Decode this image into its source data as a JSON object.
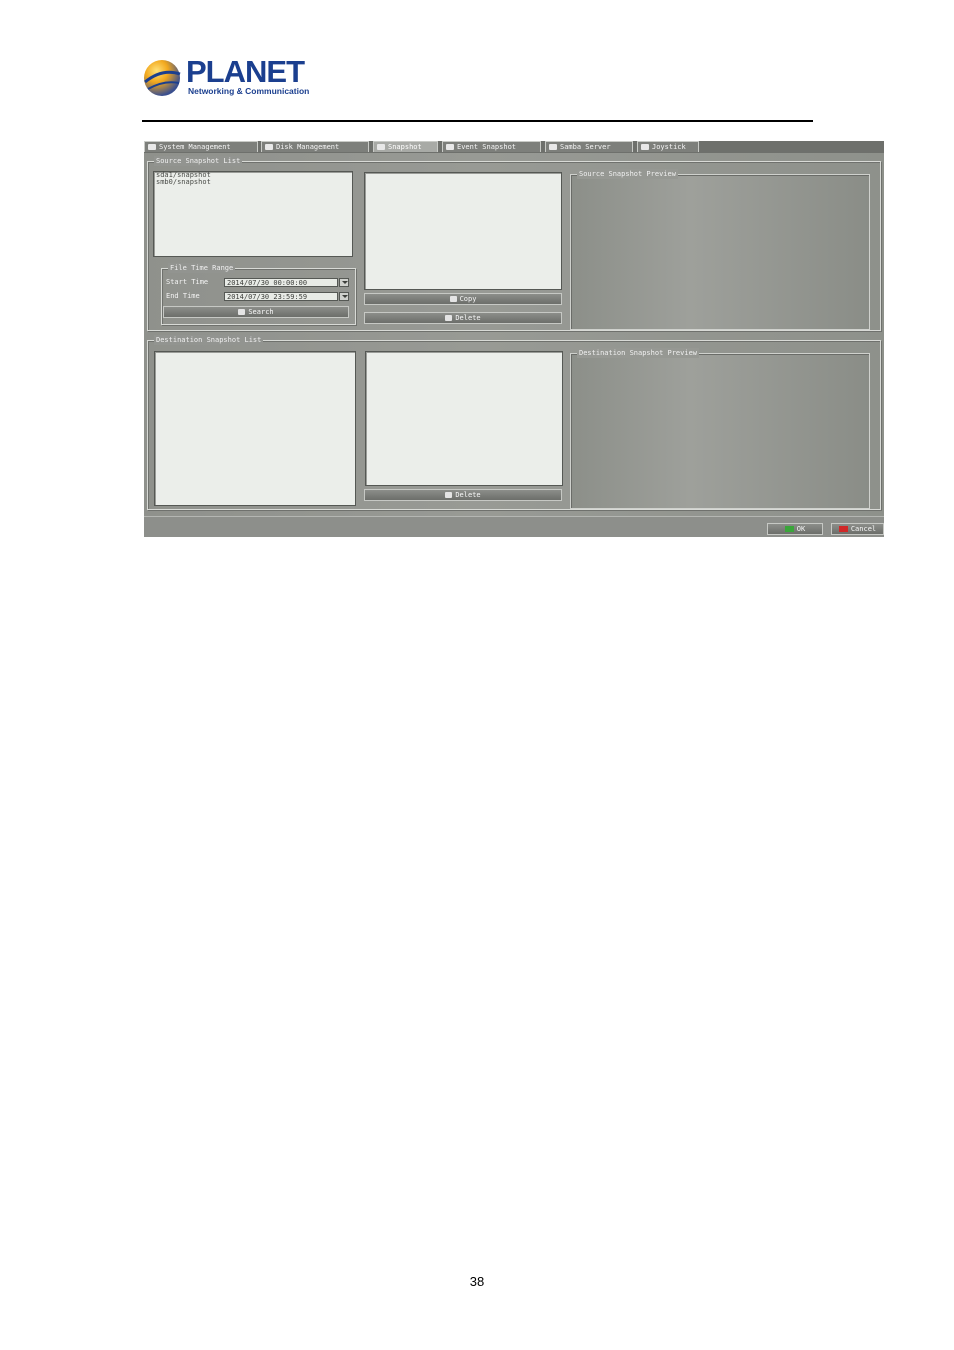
{
  "document": {
    "logo_word": "PLANET",
    "logo_tagline": "Networking & Communication",
    "page_number": "38"
  },
  "screen": {
    "tabs": [
      {
        "label": "System Management",
        "icon": "system-icon"
      },
      {
        "label": "Disk Management",
        "icon": "disk-icon"
      },
      {
        "label": "Snapshot",
        "icon": "snapshot-icon",
        "active": true
      },
      {
        "label": "Event Snapshot",
        "icon": "event-icon"
      },
      {
        "label": "Samba Server",
        "icon": "samba-icon"
      },
      {
        "label": "Joystick",
        "icon": "joystick-icon"
      }
    ],
    "source": {
      "legend": "Source Snapshot List",
      "items": [
        "sda1/snapshot",
        "smb0/snapshot"
      ],
      "time_range_legend": "File Time Range",
      "start_label": "Start Time",
      "start_value": "2014/07/30 00:00:00",
      "end_label": "End Time",
      "end_value": "2014/07/30 23:59:59",
      "search_label": "Search",
      "copy_label": "Copy",
      "delete_label": "Delete",
      "preview_legend": "Source Snapshot Preview"
    },
    "destination": {
      "legend": "Destination Snapshot List",
      "delete_label": "Delete",
      "preview_legend": "Destination Snapshot Preview"
    },
    "footer": {
      "ok_label": "OK",
      "cancel_label": "Cancel"
    },
    "colors": {
      "brand_blue": "#1b3f8f",
      "ok_green": "#3aa63a",
      "cancel_red": "#d02828"
    }
  }
}
